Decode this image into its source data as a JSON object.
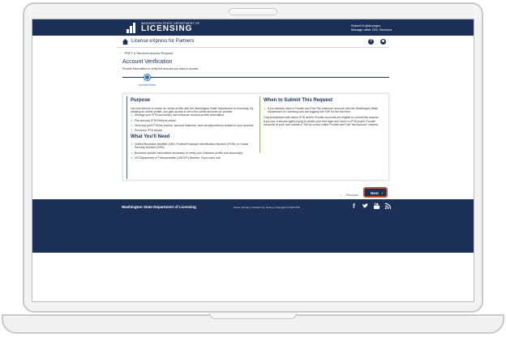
{
  "header": {
    "logo_small": "WASHINGTON STATE DEPARTMENT OF",
    "logo_big": "LICENSING",
    "user_name": "Robert N @dovegov",
    "user_sub": "Manage other DOL Services"
  },
  "nav": {
    "app_title": "License eXpress for Partners"
  },
  "breadcrumb": {
    "label": "PRFT e Services Access Request"
  },
  "page": {
    "title": "Account Verification",
    "subtitle": "Provide information to verify the account you want to access."
  },
  "steps": [
    {
      "label": "Introduction"
    }
  ],
  "purpose": {
    "heading": "Purpose",
    "intro": "Use this service to create an online profile with the Washington State Department of Licensing. By creating an online profile, you gain access to all of the online services we provide.",
    "items": [
      "Manage your IFTA account(s) and customer account profile information.",
      "File and pay IFTA Returns online.",
      "View and print FTA tax returns, account balances, and correspondence related to your account.",
      "Purchase IFTA decals."
    ],
    "need_heading": "What You'll Need",
    "need_items": [
      "Unified Business Identifier (UBI), Federal Employer Identification Number (FEIN), or Social Security Number (SSN)",
      "Business specific information necessary to verify your customer profile and account(s).",
      "US Department of Transportation (USDOT) Number, if you have one."
    ]
  },
  "when": {
    "heading": "When to Submit This Request",
    "items": [
      "If you already have a Prorate and Fuel Tax customer account with the Washington State Department of Licensing and are logging into TAP for the first time."
    ],
    "note1": "Only businesses with active IFTA and/or Prorate accounts are eligible to submit this request.",
    "note2": "If you are a service agent trying to create your first login and have no IFTA and/or Prorate accounts of your own submit a \"Set up a new online Prorate and Fuel Tax Account\" request."
  },
  "actions": {
    "previous_label": "Previous",
    "next_label": "Next",
    "next_chevron": "›",
    "previous_chevron": "‹"
  },
  "footer": {
    "org": "Washington State Department of Licensing",
    "links": "Home | Privacy | Contact Us | Survey | Copyright © 2023 DOL",
    "social": [
      "f",
      "t",
      "yt",
      "rss"
    ]
  },
  "colors": {
    "navy": "#1c3057",
    "accent_blue": "#2c6fb8",
    "accent_green": "#8ab84a",
    "highlight_orange": "#c1512b"
  }
}
